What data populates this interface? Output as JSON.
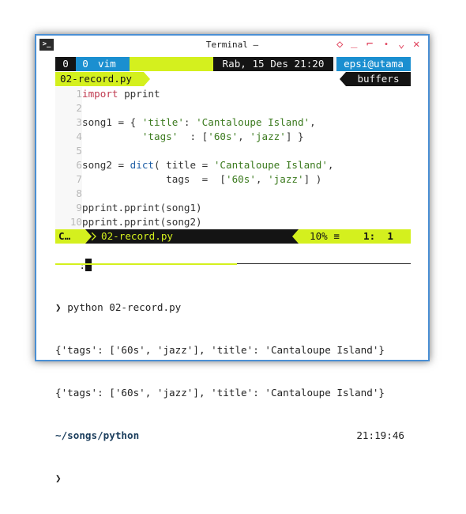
{
  "window": {
    "title": "Terminal –",
    "icon_label": ">_"
  },
  "controls": {
    "diamond": "◇",
    "minimize": "_",
    "maximize": "⌐",
    "dot": "•",
    "chevron": "⌄",
    "close": "✕"
  },
  "tmux": {
    "win0": "0",
    "win0b": "0",
    "vim": "vim",
    "datetime": "Rab, 15 Des 21:20",
    "host": "epsi@utama"
  },
  "bufferline": {
    "filename": "02-record.py",
    "buffers": "buffers"
  },
  "code": [
    {
      "n": "1",
      "parts": [
        {
          "t": "import",
          "c": "kw"
        },
        {
          "t": " pprint",
          "c": "id"
        }
      ]
    },
    {
      "n": "2",
      "parts": []
    },
    {
      "n": "3",
      "parts": [
        {
          "t": "song1 = { ",
          "c": "id"
        },
        {
          "t": "'title'",
          "c": "str"
        },
        {
          "t": ": ",
          "c": "id"
        },
        {
          "t": "'Cantaloupe Island'",
          "c": "str"
        },
        {
          "t": ",",
          "c": "id"
        }
      ]
    },
    {
      "n": "4",
      "parts": [
        {
          "t": "          ",
          "c": "id"
        },
        {
          "t": "'tags'",
          "c": "str"
        },
        {
          "t": "  : [",
          "c": "id"
        },
        {
          "t": "'60s'",
          "c": "str"
        },
        {
          "t": ", ",
          "c": "id"
        },
        {
          "t": "'jazz'",
          "c": "str"
        },
        {
          "t": "] }",
          "c": "id"
        }
      ]
    },
    {
      "n": "5",
      "parts": []
    },
    {
      "n": "6",
      "parts": [
        {
          "t": "song2 = ",
          "c": "id"
        },
        {
          "t": "dict",
          "c": "fn"
        },
        {
          "t": "( title = ",
          "c": "id"
        },
        {
          "t": "'Cantaloupe Island'",
          "c": "str"
        },
        {
          "t": ",",
          "c": "id"
        }
      ]
    },
    {
      "n": "7",
      "parts": [
        {
          "t": "              tags  =  [",
          "c": "id"
        },
        {
          "t": "'60s'",
          "c": "str"
        },
        {
          "t": ", ",
          "c": "id"
        },
        {
          "t": "'jazz'",
          "c": "str"
        },
        {
          "t": "] )",
          "c": "id"
        }
      ]
    },
    {
      "n": "8",
      "parts": []
    },
    {
      "n": "9",
      "parts": [
        {
          "t": "pprint.pprint(song1)",
          "c": "id"
        }
      ]
    },
    {
      "n": "10",
      "parts": [
        {
          "t": "pprint.pprint(song2)",
          "c": "id"
        }
      ]
    }
  ],
  "statusline": {
    "mode": "C…",
    "filename": "02-record.py",
    "percent": "10% ≡",
    "pos": "1:  1"
  },
  "cmdline": ":",
  "shell": {
    "prompt_symbol": "❯",
    "command": "python 02-record.py",
    "output": [
      "{'tags': ['60s', 'jazz'], 'title': 'Cantaloupe Island'}",
      "{'tags': ['60s', 'jazz'], 'title': 'Cantaloupe Island'}"
    ],
    "path_prefix": "~/songs/",
    "path_dir": "python",
    "time": "21:19:46"
  },
  "colors": {
    "accent_yellow": "#d4f01e",
    "tmux_blue": "#1b8fd0",
    "dark": "#141414",
    "border": "#4a8fd4"
  }
}
